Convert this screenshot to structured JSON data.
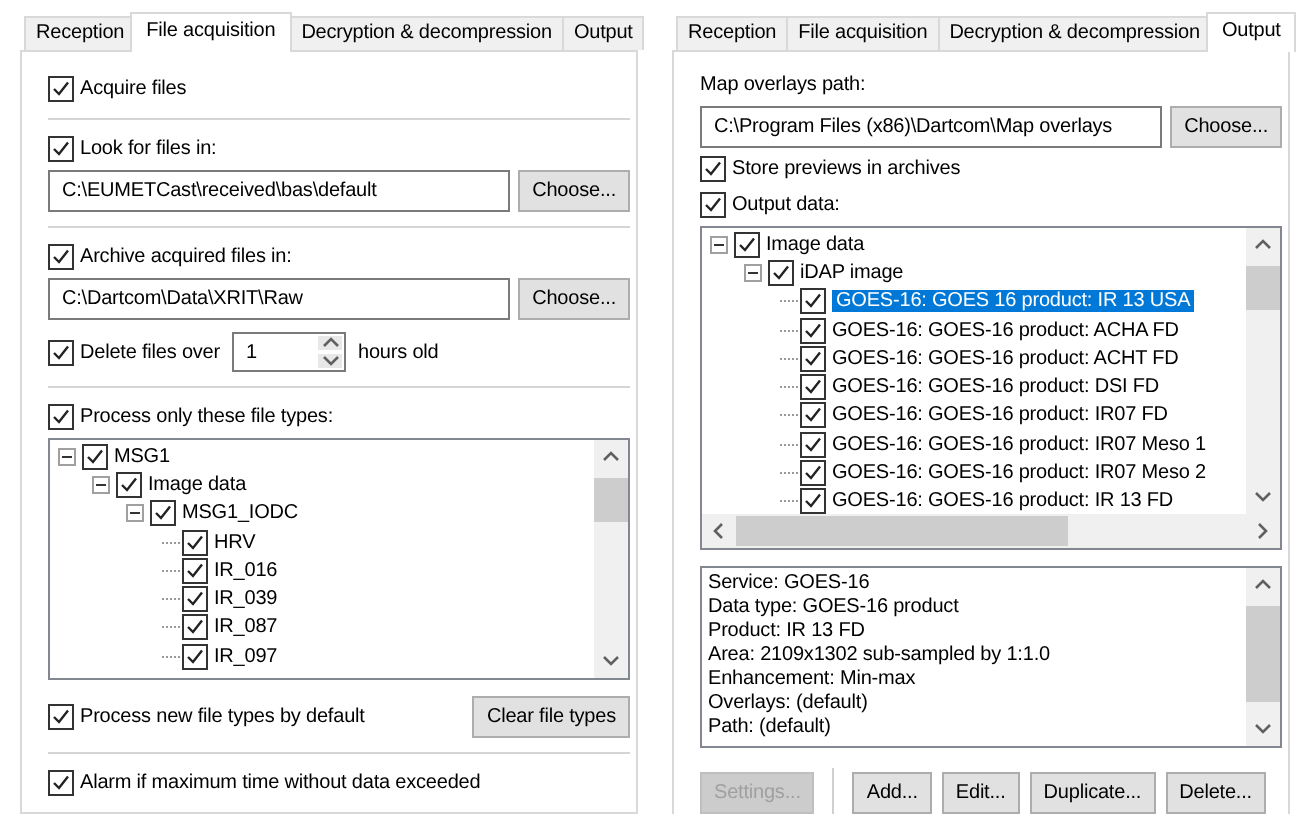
{
  "dialogs": [
    {
      "tabs": [
        {
          "label": "Reception",
          "selected": false
        },
        {
          "label": "File acquisition",
          "selected": true
        },
        {
          "label": "Decryption & decompression",
          "selected": false
        },
        {
          "label": "Output",
          "selected": false
        }
      ],
      "groups": [
        [
          {
            "kind": "check",
            "label": "Acquire files",
            "checked": true
          }
        ],
        [
          {
            "kind": "check",
            "label": "Look for files in:",
            "checked": true
          },
          {
            "kind": "path",
            "value": "C:\\EUMETCast\\received\\bas\\default",
            "button": "Choose..."
          }
        ],
        [
          {
            "kind": "check",
            "label": "Archive acquired files in:",
            "checked": true
          },
          {
            "kind": "path",
            "value": "C:\\Dartcom\\Data\\XRIT\\Raw",
            "button": "Choose..."
          },
          {
            "kind": "spin",
            "label": "Delete files over",
            "checked": true,
            "value": "1",
            "suffix": "hours old"
          }
        ],
        [
          {
            "kind": "check",
            "label": "Process only these file types:",
            "checked": true
          },
          {
            "kind": "tree",
            "horizontal_scrollbar": false,
            "nodes": [
              {
                "label": "MSG1",
                "checked": true,
                "expanded": true,
                "children": [
                  {
                    "label": "Image data",
                    "checked": true,
                    "expanded": true,
                    "children": [
                      {
                        "label": "MSG1_IODC",
                        "checked": true,
                        "expanded": true,
                        "children": [
                          {
                            "label": "HRV",
                            "checked": true
                          },
                          {
                            "label": "IR_016",
                            "checked": true
                          },
                          {
                            "label": "IR_039",
                            "checked": true
                          },
                          {
                            "label": "IR_087",
                            "checked": true
                          },
                          {
                            "label": "IR_097",
                            "checked": true
                          }
                        ]
                      }
                    ]
                  }
                ]
              }
            ]
          },
          {
            "kind": "check_button",
            "label": "Process new file types by default",
            "checked": true,
            "button": "Clear file types"
          }
        ],
        [
          {
            "kind": "check",
            "label": "Alarm if maximum time without data exceeded",
            "checked": true
          }
        ]
      ]
    },
    {
      "tabs": [
        {
          "label": "Reception",
          "selected": false
        },
        {
          "label": "File acquisition",
          "selected": false
        },
        {
          "label": "Decryption & decompression",
          "selected": false
        },
        {
          "label": "Output",
          "selected": true
        }
      ],
      "groups": [
        [
          {
            "kind": "caption",
            "label": "Map overlays path:"
          },
          {
            "kind": "path",
            "value": "C:\\Program Files (x86)\\Dartcom\\Map overlays",
            "button": "Choose..."
          },
          {
            "kind": "check",
            "label": "Store previews in archives",
            "checked": true
          },
          {
            "kind": "check",
            "label": "Output data:",
            "checked": true
          },
          {
            "kind": "tree",
            "horizontal_scrollbar": true,
            "nodes": [
              {
                "label": "Image data",
                "checked": true,
                "expanded": true,
                "selected": false,
                "children": [
                  {
                    "label": "iDAP image",
                    "checked": true,
                    "expanded": true,
                    "selected": false,
                    "children": [
                      {
                        "label": "GOES-16: GOES 16 product: IR 13 USA",
                        "checked": true,
                        "selected": true
                      },
                      {
                        "label": "GOES-16: GOES-16 product: ACHA FD",
                        "checked": true,
                        "selected": false
                      },
                      {
                        "label": "GOES-16: GOES-16 product: ACHT FD",
                        "checked": true,
                        "selected": false
                      },
                      {
                        "label": "GOES-16: GOES-16 product: DSI FD",
                        "checked": true,
                        "selected": false
                      },
                      {
                        "label": "GOES-16: GOES-16 product: IR07 FD",
                        "checked": true,
                        "selected": false
                      },
                      {
                        "label": "GOES-16: GOES-16 product: IR07 Meso 1",
                        "checked": true,
                        "selected": false
                      },
                      {
                        "label": "GOES-16: GOES-16 product: IR07 Meso 2",
                        "checked": true,
                        "selected": false
                      },
                      {
                        "label": "GOES-16: GOES-16 product: IR 13 FD",
                        "checked": true,
                        "selected": false
                      }
                    ]
                  }
                ]
              }
            ]
          },
          {
            "kind": "info",
            "lines": [
              "Service: GOES-16",
              "Data type: GOES-16 product",
              "Product: IR 13 FD",
              "Area: 2109x1302 sub-sampled by 1:1.0",
              "Enhancement: Min-max",
              "Overlays: (default)",
              "Path: (default)"
            ]
          },
          {
            "kind": "buttons",
            "button_groups": [
              [
                {
                  "label": "Settings...",
                  "disabled": true
                }
              ],
              [
                {
                  "label": "Add...",
                  "disabled": false
                },
                {
                  "label": "Edit...",
                  "disabled": false
                },
                {
                  "label": "Duplicate...",
                  "disabled": false
                },
                {
                  "label": "Delete...",
                  "disabled": false
                }
              ]
            ]
          }
        ]
      ]
    }
  ]
}
